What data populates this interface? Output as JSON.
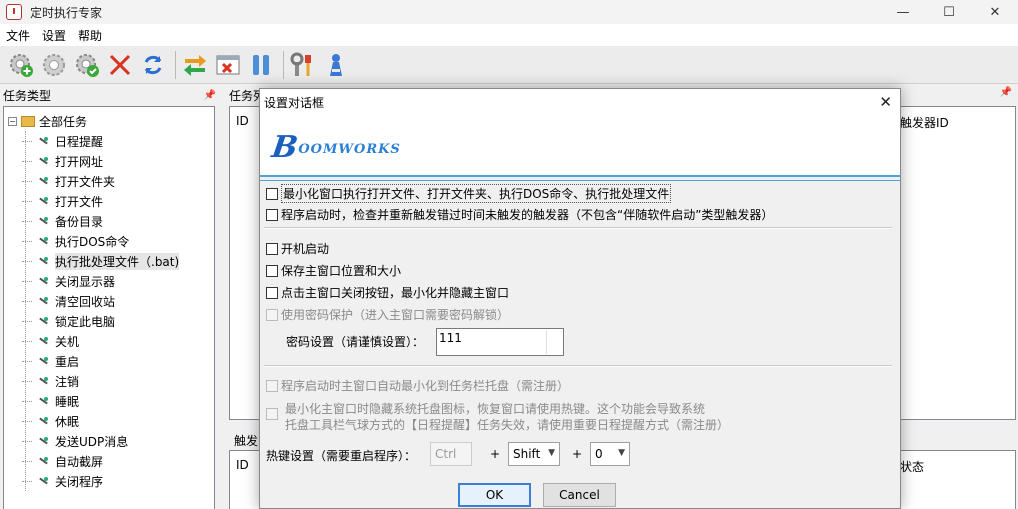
{
  "window": {
    "title": "定时执行专家",
    "minimize": "—",
    "maximize": "☐",
    "close": "✕"
  },
  "menu": [
    "文件",
    "设置",
    "帮助"
  ],
  "toolbar": {
    "buttons": [
      "add-gear-icon",
      "settings-gear-icon",
      "check-gear-icon",
      "delete-x-icon",
      "refresh-icon",
      "swap-arrows-icon",
      "window-close-icon",
      "pause-icon",
      "tools-icon",
      "user-icon"
    ]
  },
  "left_pane": {
    "title": "任务类型",
    "root": "全部任务",
    "items": [
      "日程提醒",
      "打开网址",
      "打开文件夹",
      "打开文件",
      "备份目录",
      "执行DOS命令",
      "执行批处理文件（.bat)",
      "关闭显示器",
      "清空回收站",
      "锁定此电脑",
      "关机",
      "重启",
      "注销",
      "睡眠",
      "休眠",
      "发送UDP消息",
      "自动截屏",
      "关闭程序"
    ]
  },
  "task_list": {
    "title": "任务列",
    "col_id": "ID",
    "col_trigger": "触发器ID"
  },
  "trigger_list": {
    "title": "触发",
    "col_id": "ID",
    "col_status": "状态"
  },
  "dialog": {
    "title": "设置对话框",
    "close": "✕",
    "logo_big": "B",
    "logo_rest": "OOMWORKS",
    "opt1": "最小化窗口执行打开文件、打开文件夹、执行DOS命令、执行批处理文件",
    "opt2": "程序启动时，检查并重新触发错过时间未触发的触发器（不包含“伴随软件启动”类型触发器）",
    "opt3": "开机启动",
    "opt4": "保存主窗口位置和大小",
    "opt5": "点击主窗口关闭按钮，最小化并隐藏主窗口",
    "opt6": "使用密码保护（进入主窗口需要密码解锁）",
    "pwd_label": "密码设置（请谨慎设置）：",
    "pwd_value": "111",
    "opt7": "程序启动时主窗口自动最小化到任务栏托盘（需注册）",
    "opt8_line1": "最小化主窗口时隐藏系统托盘图标，恢复窗口请使用热键。这个功能会导致系统",
    "opt8_line2": "托盘工具栏气球方式的【日程提醒】任务失效，请使用重要日程提醒方式（需注册）",
    "hotkey_label": "热键设置（需要重启程序）：",
    "combo1": "Ctrl",
    "combo2": "Shift",
    "combo3": "0",
    "plus": "+",
    "ok": "OK",
    "cancel": "Cancel"
  },
  "colors": {
    "accent": "#3c7fd4",
    "banner_line": "#4aa6d8",
    "logo": "#1b5fbf"
  }
}
